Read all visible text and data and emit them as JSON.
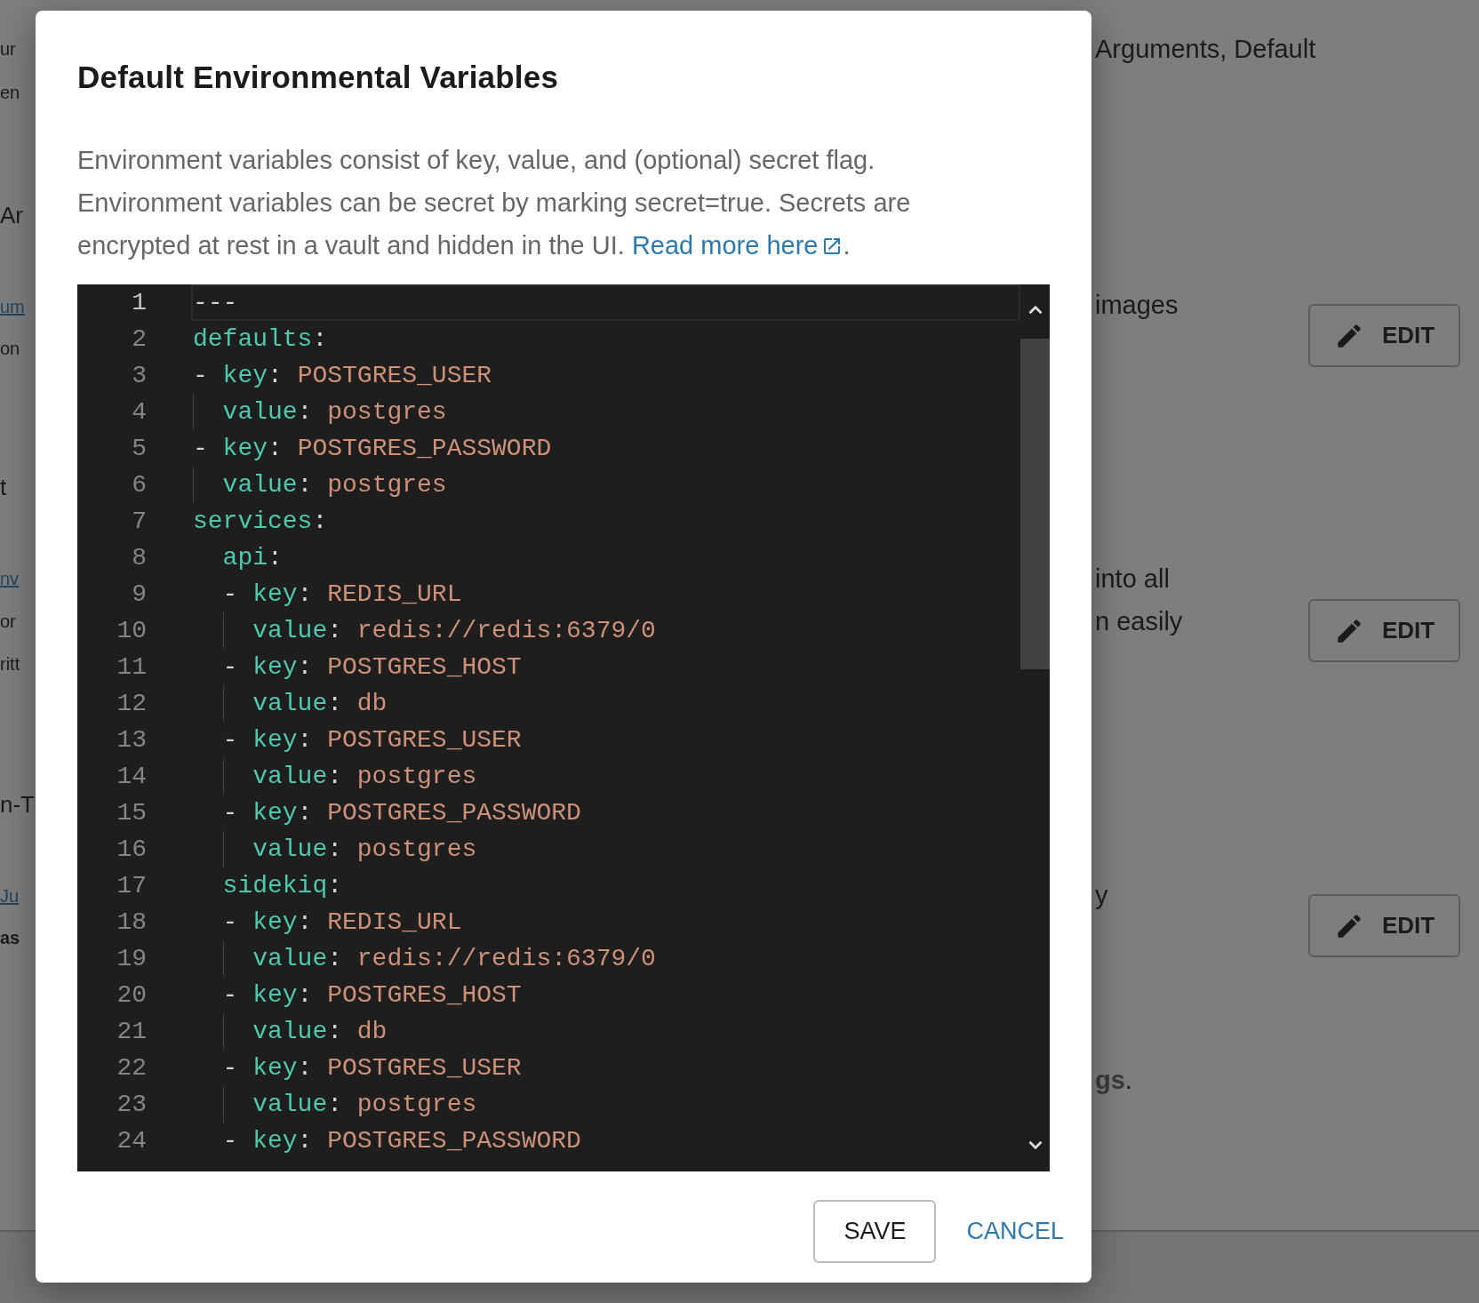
{
  "background_page": {
    "left_fragments": [
      {
        "text": "ur",
        "kind": "text"
      },
      {
        "text": "en",
        "kind": "text"
      },
      {
        "text": "Ar",
        "kind": "heading"
      },
      {
        "text": "um",
        "kind": "link"
      },
      {
        "text": "on",
        "kind": "text"
      },
      {
        "text": "t",
        "kind": "heading"
      },
      {
        "text": "nv",
        "kind": "link"
      },
      {
        "text": "or",
        "kind": "text"
      },
      {
        "text": "ritt",
        "kind": "text"
      },
      {
        "text": "n-T",
        "kind": "heading"
      },
      {
        "text": "Ju",
        "kind": "link"
      },
      {
        "text": "as",
        "kind": "bold"
      }
    ],
    "right_fragments": [
      {
        "text": "Arguments, Default"
      },
      {
        "text": "images"
      },
      {
        "text": " into all"
      },
      {
        "text": "n easily"
      },
      {
        "text": "y"
      },
      {
        "text": "**gs**."
      }
    ],
    "edit_buttons": [
      "EDIT",
      "EDIT",
      "EDIT"
    ]
  },
  "dialog": {
    "title": "Default Environmental Variables",
    "description": {
      "text": "Environment variables consist of key, value, and (optional) secret flag. Environment variables can be secret by marking secret=true. Secrets are encrypted at rest in a vault and hidden in the UI. ",
      "link": "Read more here",
      "after_link": "."
    },
    "editor": {
      "lines": [
        {
          "number": "1",
          "current": true,
          "nested": false,
          "plain": "---"
        },
        {
          "number": "2",
          "current": false,
          "nested": false,
          "key": "defaults",
          "colon": ":"
        },
        {
          "number": "3",
          "current": false,
          "nested": false,
          "marker": "-",
          "key": "key",
          "colon": ":",
          "value": "POSTGRES_USER"
        },
        {
          "number": "4",
          "current": false,
          "nested": false,
          "key": "value",
          "colon": ":",
          "value": "postgres"
        },
        {
          "number": "5",
          "current": false,
          "nested": false,
          "marker": "-",
          "key": "key",
          "colon": ":",
          "value": "POSTGRES_PASSWORD"
        },
        {
          "number": "6",
          "current": false,
          "nested": false,
          "key": "value",
          "colon": ":",
          "value": "postgres"
        },
        {
          "number": "7",
          "current": false,
          "nested": false,
          "key": "services",
          "colon": ":"
        },
        {
          "number": "8",
          "current": false,
          "nested": true,
          "key": "api",
          "colon": ":"
        },
        {
          "number": "9",
          "current": false,
          "nested": true,
          "marker": "-",
          "key": "key",
          "colon": ":",
          "value": "REDIS_URL"
        },
        {
          "number": "10",
          "current": false,
          "nested": true,
          "key": "value",
          "colon": ":",
          "value": "redis://redis:6379/0"
        },
        {
          "number": "11",
          "current": false,
          "nested": true,
          "marker": "-",
          "key": "key",
          "colon": ":",
          "value": "POSTGRES_HOST"
        },
        {
          "number": "12",
          "current": false,
          "nested": true,
          "key": "value",
          "colon": ":",
          "value": "db"
        },
        {
          "number": "13",
          "current": false,
          "nested": true,
          "marker": "-",
          "key": "key",
          "colon": ":",
          "value": "POSTGRES_USER"
        },
        {
          "number": "14",
          "current": false,
          "nested": true,
          "key": "value",
          "colon": ":",
          "value": "postgres"
        },
        {
          "number": "15",
          "current": false,
          "nested": true,
          "marker": "-",
          "key": "key",
          "colon": ":",
          "value": "POSTGRES_PASSWORD"
        },
        {
          "number": "16",
          "current": false,
          "nested": true,
          "key": "value",
          "colon": ":",
          "value": "postgres"
        },
        {
          "number": "17",
          "current": false,
          "nested": true,
          "key": "sidekiq",
          "colon": ":"
        },
        {
          "number": "18",
          "current": false,
          "nested": true,
          "marker": "-",
          "key": "key",
          "colon": ":",
          "value": "REDIS_URL"
        },
        {
          "number": "19",
          "current": false,
          "nested": true,
          "key": "value",
          "colon": ":",
          "value": "redis://redis:6379/0"
        },
        {
          "number": "20",
          "current": false,
          "nested": true,
          "marker": "-",
          "key": "key",
          "colon": ":",
          "value": "POSTGRES_HOST"
        },
        {
          "number": "21",
          "current": false,
          "nested": true,
          "key": "value",
          "colon": ":",
          "value": "db"
        },
        {
          "number": "22",
          "current": false,
          "nested": true,
          "marker": "-",
          "key": "key",
          "colon": ":",
          "value": "POSTGRES_USER"
        },
        {
          "number": "23",
          "current": false,
          "nested": true,
          "key": "value",
          "colon": ":",
          "value": "postgres"
        },
        {
          "number": "24",
          "current": false,
          "nested": true,
          "marker": "-",
          "key": "key",
          "colon": ":",
          "value": "POSTGRES_PASSWORD"
        }
      ]
    },
    "buttons": [
      {
        "label": "SAVE",
        "kind": "outlined"
      },
      {
        "label": "CANCEL",
        "kind": "text"
      }
    ]
  }
}
